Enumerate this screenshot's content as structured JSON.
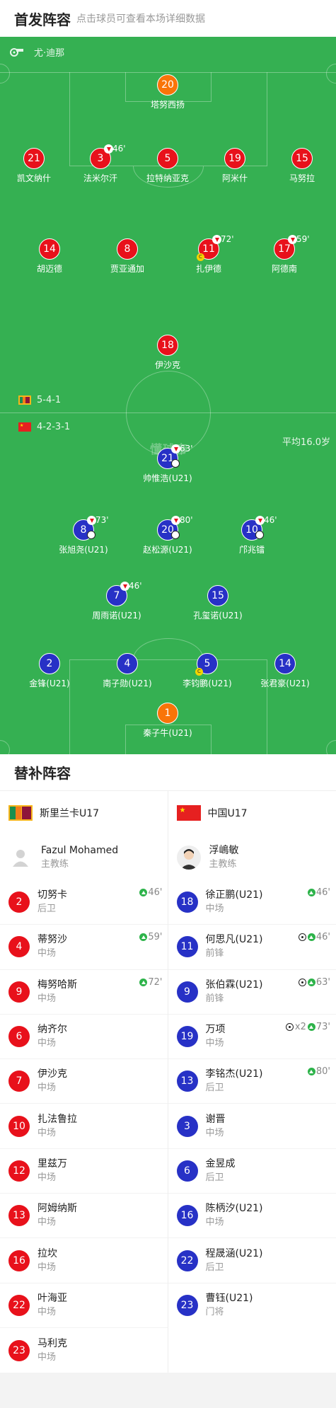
{
  "header": {
    "title": "首发阵容",
    "subtitle": "点击球员可查看本场详细数据"
  },
  "pitch": {
    "referee": "尤·迪那",
    "watermark": "懂球帝",
    "home_formation": "5-4-1",
    "away_formation": "4-2-3-1",
    "away_avg_age": "平均16.0岁",
    "home_players": [
      {
        "num": "20",
        "name": "塔努西扬",
        "color": "org"
      },
      {
        "num": "21",
        "name": "凯文纳什",
        "color": "red"
      },
      {
        "num": "3",
        "name": "法米尔汗",
        "color": "red",
        "sub": "46'"
      },
      {
        "num": "5",
        "name": "拉特纳亚克",
        "color": "red"
      },
      {
        "num": "19",
        "name": "阿米什",
        "color": "red"
      },
      {
        "num": "15",
        "name": "马努拉",
        "color": "red"
      },
      {
        "num": "14",
        "name": "胡迈德",
        "color": "red"
      },
      {
        "num": "8",
        "name": "贾亚通加",
        "color": "red"
      },
      {
        "num": "11",
        "name": "扎伊德",
        "color": "red",
        "sub": "72'",
        "captain": "C"
      },
      {
        "num": "17",
        "name": "阿德南",
        "color": "red",
        "sub": "59'"
      },
      {
        "num": "18",
        "name": "伊沙克",
        "color": "red"
      }
    ],
    "away_players": [
      {
        "num": "21",
        "name": "帅惟浩(U21)",
        "color": "blue",
        "sub": "63'",
        "ball": true
      },
      {
        "num": "8",
        "name": "张旭尧(U21)",
        "color": "blue",
        "sub": "73'",
        "ball": true
      },
      {
        "num": "20",
        "name": "赵松源(U21)",
        "color": "blue",
        "sub": "80'",
        "ball": true
      },
      {
        "num": "10",
        "name": "邝兆镭",
        "color": "blue",
        "sub": "46'",
        "ball": true
      },
      {
        "num": "7",
        "name": "周雨诺(U21)",
        "color": "blue",
        "sub": "46'"
      },
      {
        "num": "15",
        "name": "孔玺诺(U21)",
        "color": "blue"
      },
      {
        "num": "2",
        "name": "金锋(U21)",
        "color": "blue"
      },
      {
        "num": "4",
        "name": "南子勋(U21)",
        "color": "blue"
      },
      {
        "num": "5",
        "name": "李钧鹏(U21)",
        "color": "blue",
        "captain": "C"
      },
      {
        "num": "14",
        "name": "张君豪(U21)",
        "color": "blue"
      },
      {
        "num": "1",
        "name": "秦子牛(U21)",
        "color": "org"
      }
    ]
  },
  "subs": {
    "title": "替补阵容",
    "home": {
      "team": "斯里兰卡U17",
      "coach_name": "Fazul Mohamed",
      "coach_role": "主教练",
      "players": [
        {
          "num": "2",
          "name": "切努卡",
          "pos": "后卫",
          "in": "46'"
        },
        {
          "num": "4",
          "name": "蒂努沙",
          "pos": "中场",
          "in": "59'"
        },
        {
          "num": "9",
          "name": "梅努哈斯",
          "pos": "中场",
          "in": "72'"
        },
        {
          "num": "6",
          "name": "纳齐尔",
          "pos": "中场"
        },
        {
          "num": "7",
          "name": "伊沙克",
          "pos": "中场"
        },
        {
          "num": "10",
          "name": "扎法鲁拉",
          "pos": "中场"
        },
        {
          "num": "12",
          "name": "里兹万",
          "pos": "中场"
        },
        {
          "num": "13",
          "name": "阿姆纳斯",
          "pos": "中场"
        },
        {
          "num": "16",
          "name": "拉坎",
          "pos": "中场"
        },
        {
          "num": "22",
          "name": "叶海亚",
          "pos": "中场"
        },
        {
          "num": "23",
          "name": "马利克",
          "pos": "中场"
        }
      ]
    },
    "away": {
      "team": "中国U17",
      "coach_name": "浮嶋敏",
      "coach_role": "主教练",
      "players": [
        {
          "num": "18",
          "name": "徐正鹏(U21)",
          "pos": "中场",
          "in": "46'"
        },
        {
          "num": "11",
          "name": "何思凡(U21)",
          "pos": "前锋",
          "in": "46'",
          "goal": true
        },
        {
          "num": "9",
          "name": "张伯霖(U21)",
          "pos": "前锋",
          "in": "63'",
          "goal": true
        },
        {
          "num": "19",
          "name": "万项",
          "pos": "中场",
          "in": "73'",
          "goal": true,
          "goal_count": "x2"
        },
        {
          "num": "13",
          "name": "李铭杰(U21)",
          "pos": "后卫",
          "in": "80'"
        },
        {
          "num": "3",
          "name": "谢晋",
          "pos": "中场"
        },
        {
          "num": "6",
          "name": "金昱成",
          "pos": "后卫"
        },
        {
          "num": "16",
          "name": "陈柄汐(U21)",
          "pos": "中场"
        },
        {
          "num": "22",
          "name": "程晟涵(U21)",
          "pos": "后卫"
        },
        {
          "num": "23",
          "name": "曹钰(U21)",
          "pos": "门将"
        }
      ]
    }
  }
}
